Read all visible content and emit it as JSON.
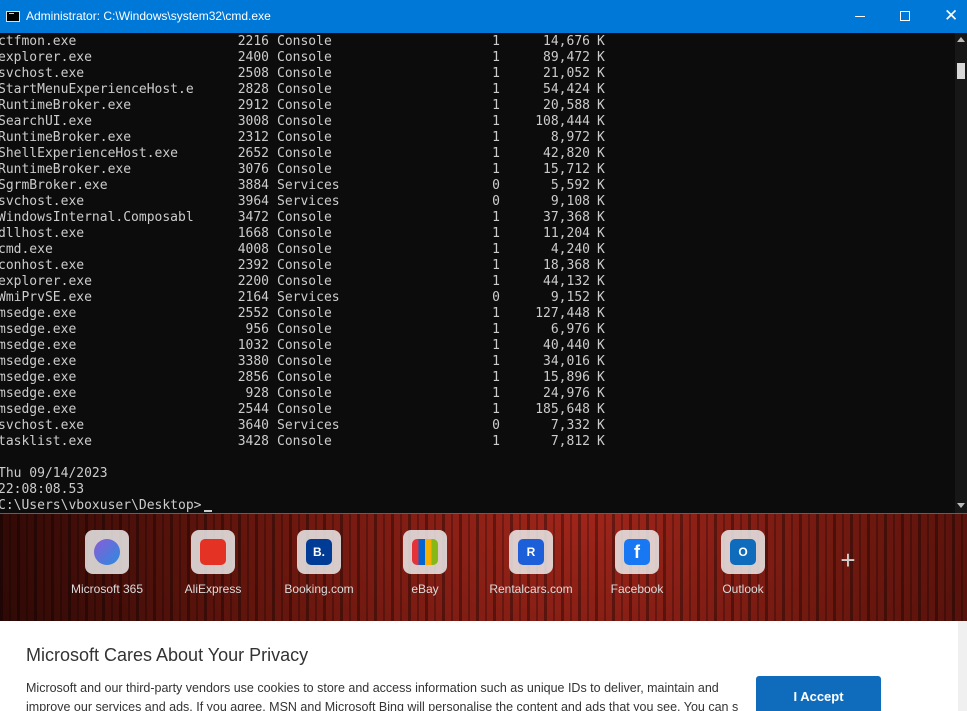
{
  "window": {
    "title": "Administrator: C:\\Windows\\system32\\cmd.exe",
    "close_glyph": "✕"
  },
  "processes": [
    {
      "name": "ctfmon.exe",
      "pid": "2216",
      "session": "Console",
      "num": "1",
      "mem": "14,676",
      "unit": "K"
    },
    {
      "name": "explorer.exe",
      "pid": "2400",
      "session": "Console",
      "num": "1",
      "mem": "89,472",
      "unit": "K"
    },
    {
      "name": "svchost.exe",
      "pid": "2508",
      "session": "Console",
      "num": "1",
      "mem": "21,052",
      "unit": "K"
    },
    {
      "name": "StartMenuExperienceHost.e",
      "pid": "2828",
      "session": "Console",
      "num": "1",
      "mem": "54,424",
      "unit": "K"
    },
    {
      "name": "RuntimeBroker.exe",
      "pid": "2912",
      "session": "Console",
      "num": "1",
      "mem": "20,588",
      "unit": "K"
    },
    {
      "name": "SearchUI.exe",
      "pid": "3008",
      "session": "Console",
      "num": "1",
      "mem": "108,444",
      "unit": "K"
    },
    {
      "name": "RuntimeBroker.exe",
      "pid": "2312",
      "session": "Console",
      "num": "1",
      "mem": "8,972",
      "unit": "K"
    },
    {
      "name": "ShellExperienceHost.exe",
      "pid": "2652",
      "session": "Console",
      "num": "1",
      "mem": "42,820",
      "unit": "K"
    },
    {
      "name": "RuntimeBroker.exe",
      "pid": "3076",
      "session": "Console",
      "num": "1",
      "mem": "15,712",
      "unit": "K"
    },
    {
      "name": "SgrmBroker.exe",
      "pid": "3884",
      "session": "Services",
      "num": "0",
      "mem": "5,592",
      "unit": "K"
    },
    {
      "name": "svchost.exe",
      "pid": "3964",
      "session": "Services",
      "num": "0",
      "mem": "9,108",
      "unit": "K"
    },
    {
      "name": "WindowsInternal.Composabl",
      "pid": "3472",
      "session": "Console",
      "num": "1",
      "mem": "37,368",
      "unit": "K"
    },
    {
      "name": "dllhost.exe",
      "pid": "1668",
      "session": "Console",
      "num": "1",
      "mem": "11,204",
      "unit": "K"
    },
    {
      "name": "cmd.exe",
      "pid": "4008",
      "session": "Console",
      "num": "1",
      "mem": "4,240",
      "unit": "K"
    },
    {
      "name": "conhost.exe",
      "pid": "2392",
      "session": "Console",
      "num": "1",
      "mem": "18,368",
      "unit": "K"
    },
    {
      "name": "explorer.exe",
      "pid": "2200",
      "session": "Console",
      "num": "1",
      "mem": "44,132",
      "unit": "K"
    },
    {
      "name": "WmiPrvSE.exe",
      "pid": "2164",
      "session": "Services",
      "num": "0",
      "mem": "9,152",
      "unit": "K"
    },
    {
      "name": "msedge.exe",
      "pid": "2552",
      "session": "Console",
      "num": "1",
      "mem": "127,448",
      "unit": "K"
    },
    {
      "name": "msedge.exe",
      "pid": "956",
      "session": "Console",
      "num": "1",
      "mem": "6,976",
      "unit": "K"
    },
    {
      "name": "msedge.exe",
      "pid": "1032",
      "session": "Console",
      "num": "1",
      "mem": "40,440",
      "unit": "K"
    },
    {
      "name": "msedge.exe",
      "pid": "3380",
      "session": "Console",
      "num": "1",
      "mem": "34,016",
      "unit": "K"
    },
    {
      "name": "msedge.exe",
      "pid": "2856",
      "session": "Console",
      "num": "1",
      "mem": "15,896",
      "unit": "K"
    },
    {
      "name": "msedge.exe",
      "pid": "928",
      "session": "Console",
      "num": "1",
      "mem": "24,976",
      "unit": "K"
    },
    {
      "name": "msedge.exe",
      "pid": "2544",
      "session": "Console",
      "num": "1",
      "mem": "185,648",
      "unit": "K"
    },
    {
      "name": "svchost.exe",
      "pid": "3640",
      "session": "Services",
      "num": "0",
      "mem": "7,332",
      "unit": "K"
    },
    {
      "name": "tasklist.exe",
      "pid": "3428",
      "session": "Console",
      "num": "1",
      "mem": "7,812",
      "unit": "K"
    }
  ],
  "console_footer": {
    "date_line": "Thu 09/14/2023",
    "time_line": "22:08:08.53",
    "prompt": "C:\\Users\\vboxuser\\Desktop>"
  },
  "shortcuts": [
    {
      "label": "Microsoft 365",
      "icon": "microsoft-365-icon",
      "color": "#8a5cd6"
    },
    {
      "label": "AliExpress",
      "icon": "aliexpress-icon",
      "color": "#e43225"
    },
    {
      "label": "Booking.com",
      "icon": "booking-icon",
      "color": "#003b95",
      "glyph": "B."
    },
    {
      "label": "eBay",
      "icon": "ebay-icon",
      "color": "#e53238"
    },
    {
      "label": "Rentalcars.com",
      "icon": "rentalcars-icon",
      "color": "#1c5fd9",
      "glyph": "R"
    },
    {
      "label": "Facebook",
      "icon": "facebook-icon",
      "color": "#1877f2",
      "glyph": "f"
    },
    {
      "label": "Outlook",
      "icon": "outlook-icon",
      "color": "#0f6cbd",
      "glyph": "O"
    }
  ],
  "add_shortcut_glyph": "+",
  "privacy": {
    "title": "Microsoft Cares About Your Privacy",
    "text": "Microsoft and our third-party vendors use cookies to store and access information such as unique IDs to deliver, maintain and improve our services and ads. If you agree, MSN and Microsoft Bing will personalise the content and ads that you see. You can s",
    "accept_label": "I Accept"
  }
}
